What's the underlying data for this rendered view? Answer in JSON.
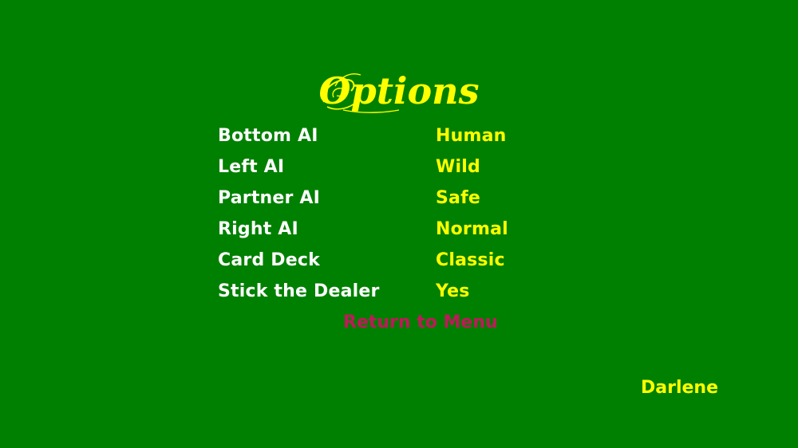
{
  "title": "Options",
  "options": [
    {
      "label": "Bottom AI",
      "value": "Human"
    },
    {
      "label": "Left AI",
      "value": "Wild"
    },
    {
      "label": "Partner AI",
      "value": "Safe"
    },
    {
      "label": "Right AI",
      "value": "Normal"
    },
    {
      "label": "Card Deck",
      "value": "Classic"
    },
    {
      "label": "Stick the Dealer",
      "value": "Yes"
    }
  ],
  "return_label": "Return to Menu",
  "player_name": "Darlene",
  "colors": {
    "background": "#008000",
    "label": "#ffffff",
    "value": "#ffff00",
    "return": "#c0185a",
    "title": "#ffff00"
  }
}
